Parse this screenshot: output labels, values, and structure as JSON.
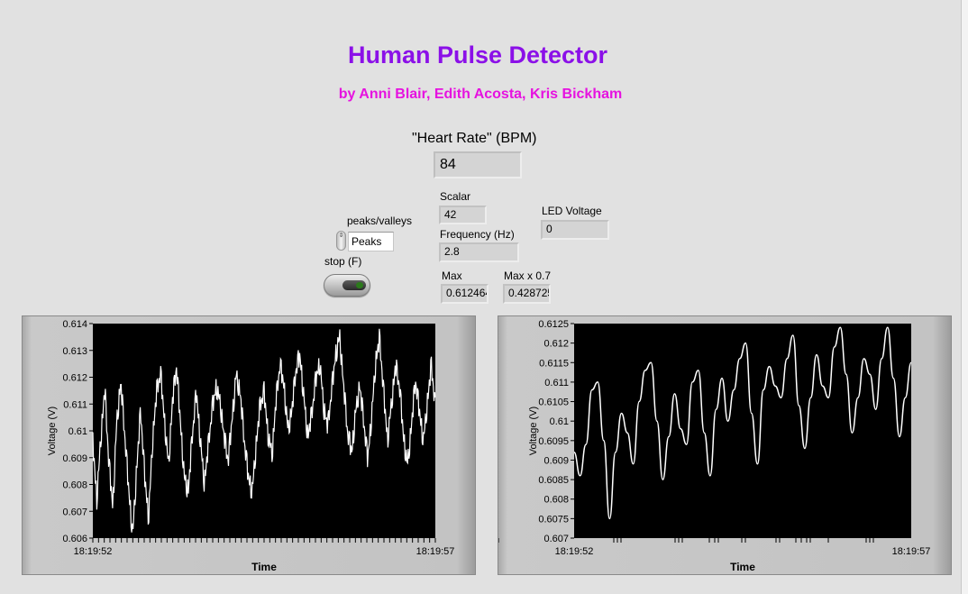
{
  "title": "Human Pulse Detector",
  "authors": "by Anni Blair, Edith Acosta, Kris Bickham",
  "heart_rate": {
    "label": "\"Heart Rate\" (BPM)",
    "value": "84"
  },
  "scalar": {
    "label": "Scalar",
    "value": "42"
  },
  "frequency": {
    "label": "Frequency (Hz)",
    "value": "2.8"
  },
  "led_voltage": {
    "label": "LED Voltage",
    "value": "0"
  },
  "max": {
    "label": "Max",
    "value": "0.612464"
  },
  "max_x07": {
    "label": "Max x 0.7",
    "value": "0.428725"
  },
  "peaks_valleys": {
    "label": "peaks/valleys",
    "value": "Peaks"
  },
  "stop": {
    "label": "stop (F)"
  },
  "colors": {
    "title": "#8b10e8",
    "authors": "#e612e0",
    "plot_bg": "#000000",
    "trace": "#ffffff"
  },
  "chart_data": [
    {
      "type": "line",
      "title": "",
      "xlabel": "Time",
      "ylabel": "Voltage (V)",
      "x_ticks": [
        "18:19:52",
        "18:19:57"
      ],
      "y_ticks": [
        "0.606",
        "0.607",
        "0.608",
        "0.609",
        "0.61",
        "0.611",
        "0.612",
        "0.613",
        "0.614"
      ],
      "ylim": [
        0.606,
        0.614
      ],
      "grid": false,
      "series": [
        {
          "values": [
            0.6095,
            0.6075,
            0.6098,
            0.6115,
            0.6088,
            0.6072,
            0.6104,
            0.6118,
            0.6098,
            0.6078,
            0.6062,
            0.6086,
            0.6107,
            0.6083,
            0.6068,
            0.6097,
            0.6114,
            0.6121,
            0.6104,
            0.6088,
            0.6111,
            0.6123,
            0.6103,
            0.6083,
            0.6078,
            0.6098,
            0.6114,
            0.6097,
            0.6081,
            0.6094,
            0.6108,
            0.6117,
            0.6111,
            0.6097,
            0.6088,
            0.6105,
            0.6122,
            0.6114,
            0.6096,
            0.6083,
            0.6078,
            0.6095,
            0.6109,
            0.6114,
            0.6099,
            0.6092,
            0.6111,
            0.6124,
            0.6117,
            0.6101,
            0.6108,
            0.6122,
            0.6128,
            0.6113,
            0.6098,
            0.6106,
            0.6119,
            0.6126,
            0.6109,
            0.6101,
            0.6115,
            0.6129,
            0.6136,
            0.6116,
            0.6098,
            0.6092,
            0.6108,
            0.6117,
            0.6103,
            0.6089,
            0.6106,
            0.6126,
            0.6134,
            0.6114,
            0.6097,
            0.6111,
            0.6124,
            0.6116,
            0.6098,
            0.6088,
            0.6102,
            0.6118,
            0.6107,
            0.6097,
            0.6111,
            0.6124,
            0.6108
          ]
        }
      ]
    },
    {
      "type": "line",
      "title": "",
      "xlabel": "Time",
      "ylabel": "Voltage (V)",
      "x_ticks": [
        "18:19:52",
        "18:19:57"
      ],
      "y_ticks": [
        "0.607",
        "0.6075",
        "0.608",
        "0.6085",
        "0.609",
        "0.6095",
        "0.61",
        "0.6105",
        "0.611",
        "0.6115",
        "0.612",
        "0.6125"
      ],
      "ylim": [
        0.607,
        0.6125
      ],
      "grid": false,
      "series": [
        {
          "values": [
            0.6092,
            0.6086,
            0.6094,
            0.6108,
            0.611,
            0.6095,
            0.6075,
            0.6092,
            0.6102,
            0.6097,
            0.6089,
            0.6105,
            0.6113,
            0.6115,
            0.61,
            0.6085,
            0.6096,
            0.6107,
            0.6098,
            0.6094,
            0.611,
            0.6113,
            0.6097,
            0.6086,
            0.6103,
            0.6111,
            0.61,
            0.6108,
            0.6116,
            0.612,
            0.6102,
            0.6089,
            0.6108,
            0.6114,
            0.6109,
            0.6106,
            0.6116,
            0.6122,
            0.6104,
            0.6093,
            0.6106,
            0.6117,
            0.6109,
            0.6106,
            0.6119,
            0.6124,
            0.6112,
            0.6097,
            0.6106,
            0.6116,
            0.6112,
            0.6103,
            0.6116,
            0.6124,
            0.6111,
            0.6096,
            0.6106,
            0.6115
          ]
        }
      ]
    }
  ]
}
